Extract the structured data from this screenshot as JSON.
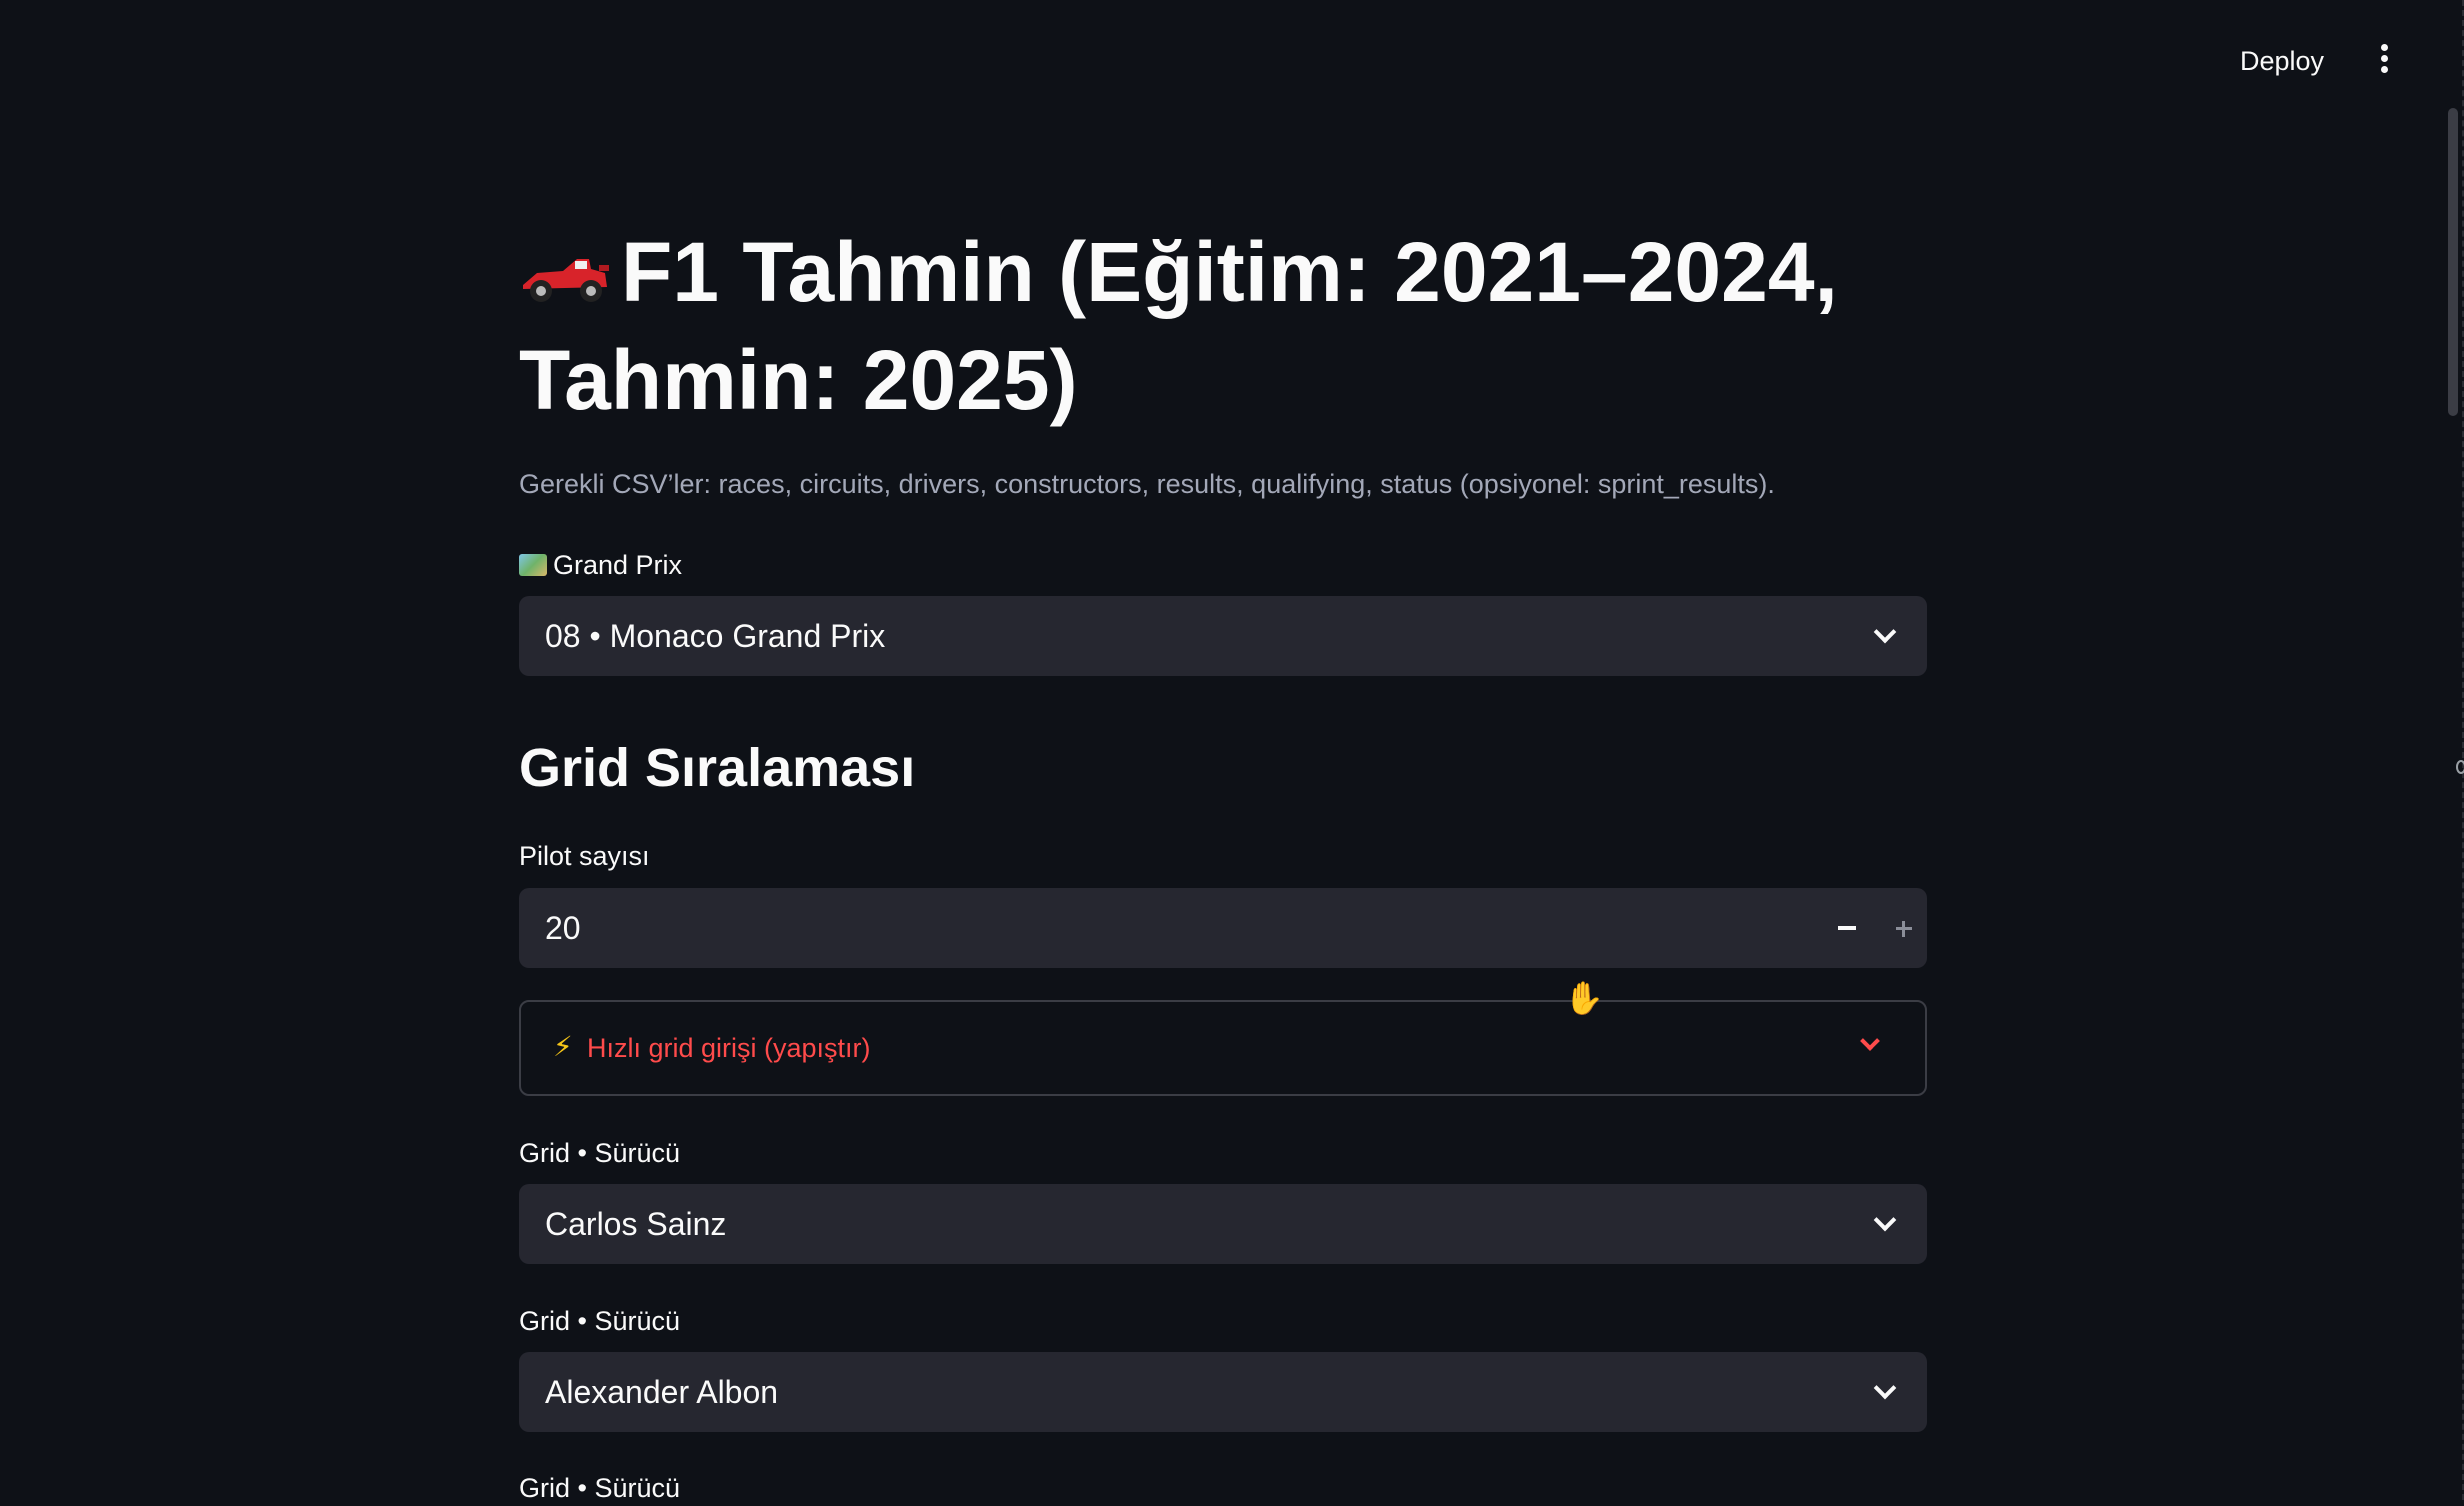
{
  "header": {
    "deploy_label": "Deploy"
  },
  "page": {
    "title": "F1 Tahmin (Eğitim: 2021–2024, Tahmin: 2025)",
    "caption": "Gerekli CSV’ler: races, circuits, drivers, constructors, results, qualifying, status (opsiyonel: sprint_results)."
  },
  "grand_prix": {
    "label": "Grand Prix",
    "selected": "08 • Monaco Grand Prix"
  },
  "grid_section": {
    "heading": "Grid Sıralaması",
    "pilot_count_label": "Pilot sayısı",
    "pilot_count_value": "20",
    "quick_entry_label": "Hızlı grid girişi (yapıştır)"
  },
  "grid_drivers": [
    {
      "label": "Grid • Sürücü",
      "selected": "Carlos Sainz"
    },
    {
      "label": "Grid • Sürücü",
      "selected": "Alexander Albon"
    },
    {
      "label": "Grid • Sürücü",
      "selected": ""
    }
  ],
  "colors": {
    "background": "#0e1117",
    "widget_bg": "#262730",
    "accent": "#ff4b4b",
    "caption": "#a3a8b8"
  },
  "icons": {
    "title": "race-car-icon",
    "grand_prix": "world-map-icon",
    "quick_entry": "lightning-icon",
    "menu": "kebab-menu-icon"
  }
}
